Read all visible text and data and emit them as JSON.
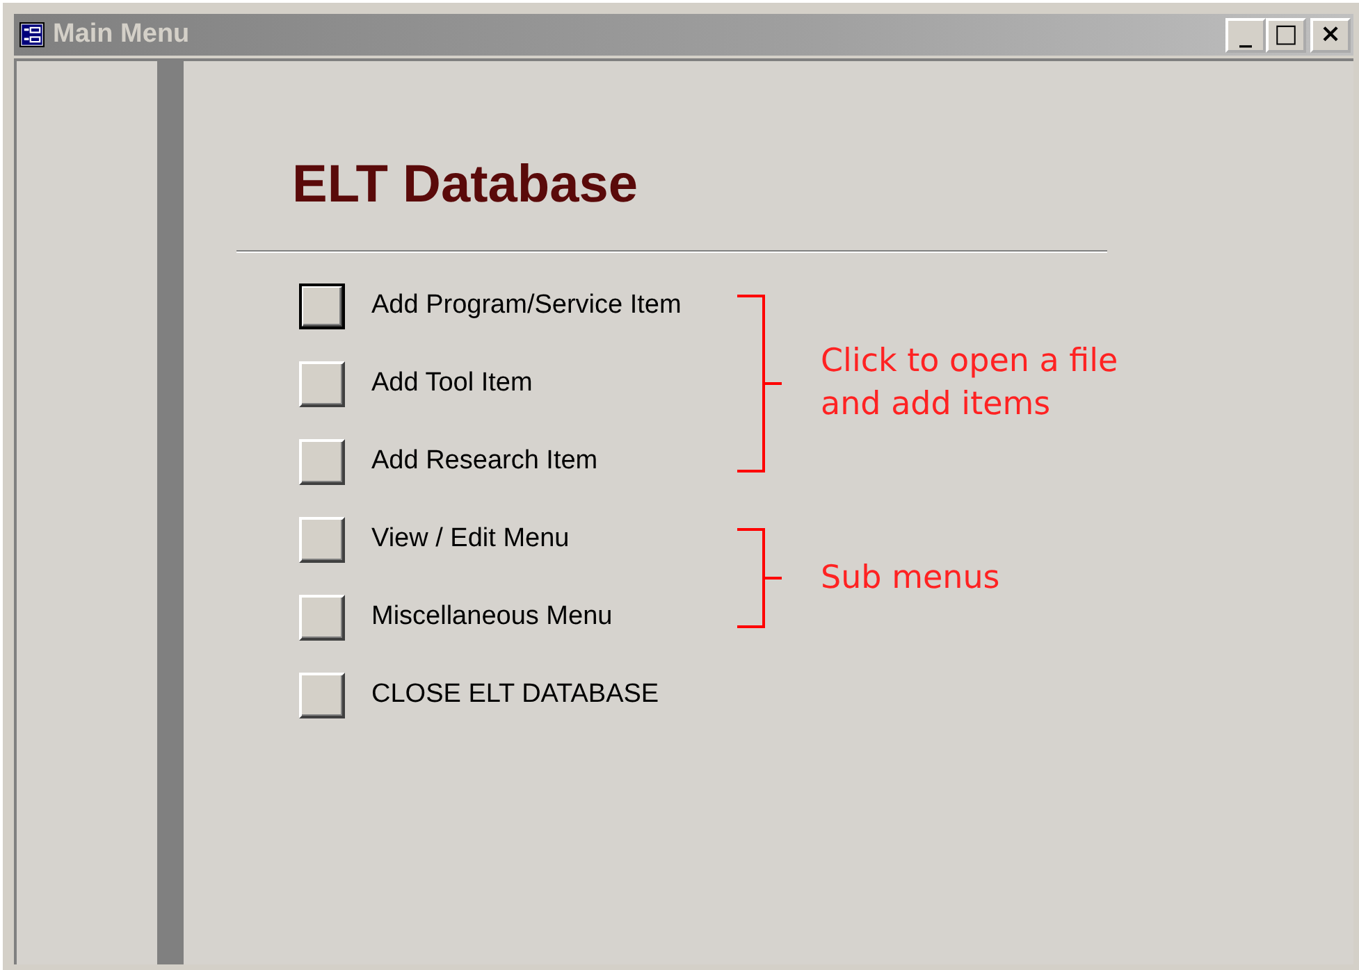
{
  "window": {
    "title": "Main Menu",
    "controls": [
      "_",
      "□",
      "×"
    ]
  },
  "heading": "ELT Database",
  "buttons": [
    {
      "label": "Add Program/Service Item",
      "selected": true
    },
    {
      "label": "Add Tool Item",
      "selected": false
    },
    {
      "label": "Add Research Item",
      "selected": false
    },
    {
      "label": "View / Edit Menu",
      "selected": false
    },
    {
      "label": "Miscellaneous Menu",
      "selected": false
    },
    {
      "label": "CLOSE ELT DATABASE",
      "selected": false
    }
  ],
  "annotations": [
    {
      "text": "Click to open a file and add items"
    },
    {
      "text": "Sub menus"
    }
  ]
}
